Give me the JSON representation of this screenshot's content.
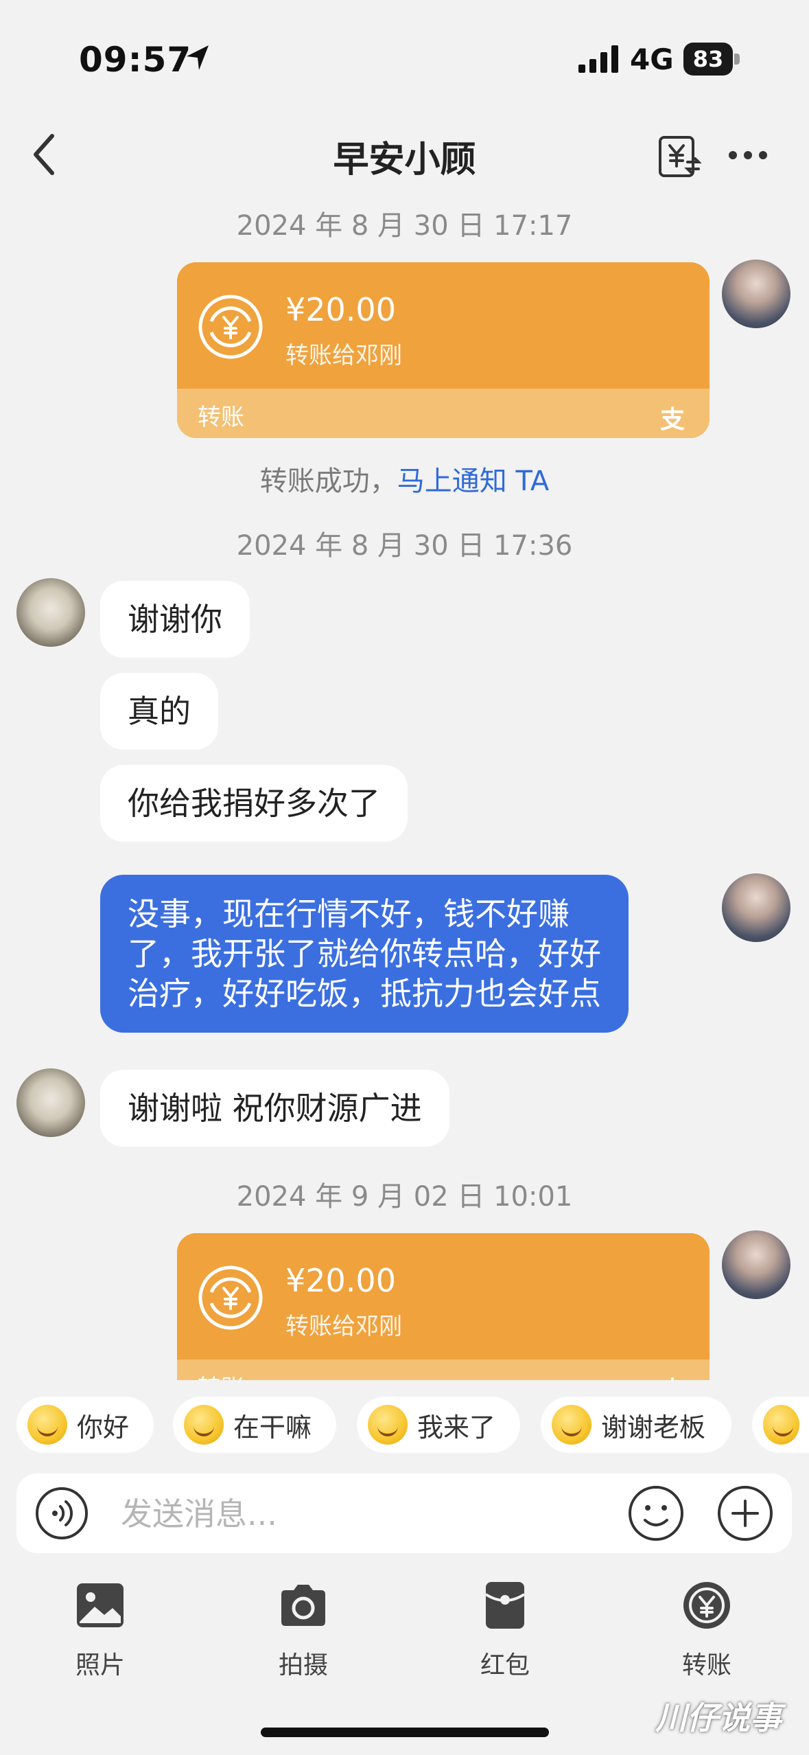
{
  "status_bar": {
    "time": "09:57",
    "network": "4G",
    "battery": "83"
  },
  "header": {
    "title": "早安小顾",
    "back_icon": "chevron-left-icon",
    "exchange_icon": "yuan-exchange-icon",
    "more_icon": "more-dots-icon"
  },
  "messages": {
    "ts1": "2024 年 8 月 30 日 17:17",
    "transfer1": {
      "amount": "¥20.00",
      "desc": "转账给邓刚",
      "label": "转账",
      "mark": "支"
    },
    "notice": {
      "text": "转账成功，",
      "link": "马上通知 TA"
    },
    "ts2": "2024 年 8 月 30 日 17:36",
    "other1": "谢谢你",
    "other2": "真的",
    "other3": "你给我捐好多次了",
    "self1": "没事，现在行情不好，钱不好赚了，我开张了就给你转点哈，好好治疗，好好吃饭，抵抗力也会好点",
    "other4": "谢谢啦 祝你财源广进",
    "ts3": "2024 年 9 月 02 日 10:01",
    "transfer2": {
      "amount": "¥20.00",
      "desc": "转账给邓刚",
      "label": "转账",
      "mark": "支"
    }
  },
  "quick_replies": [
    "你好",
    "在干嘛",
    "我来了",
    "谢谢老板"
  ],
  "input": {
    "placeholder": "发送消息..."
  },
  "toolbar": {
    "photo": "照片",
    "camera": "拍摄",
    "red_packet": "红包",
    "transfer": "转账"
  },
  "watermark": "川仔说事",
  "colors": {
    "transfer_orange": "#f0a23c",
    "self_bubble_blue": "#3b6fe0",
    "link_blue": "#2f6ad9",
    "background": "#f2f2f2"
  }
}
